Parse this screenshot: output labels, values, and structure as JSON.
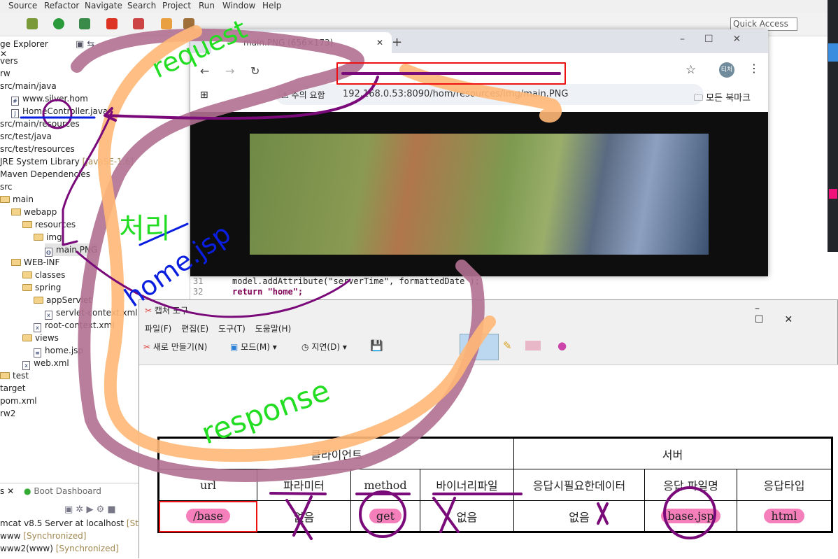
{
  "eclipse": {
    "menu": [
      "Source",
      "Refactor",
      "Navigate",
      "Search",
      "Project",
      "Run",
      "Window",
      "Help"
    ],
    "quick_access": "Quick Access",
    "explorer_tab": "ge Explorer",
    "tree": [
      {
        "label": "vers",
        "indent": 0
      },
      {
        "label": "rw",
        "indent": 0
      },
      {
        "label": "src/main/java",
        "indent": 0
      },
      {
        "label": "www.silver.hom",
        "indent": 1,
        "icon": "package"
      },
      {
        "label": "HomeController.java",
        "indent": 1,
        "icon": "java"
      },
      {
        "label": "src/main/resources",
        "indent": 0
      },
      {
        "label": "src/test/java",
        "indent": 0
      },
      {
        "label": "src/test/resources",
        "indent": 0
      },
      {
        "label": "JRE System Library",
        "suffix": "[JavaSE-1.6]",
        "indent": 0
      },
      {
        "label": "Maven Dependencies",
        "indent": 0
      },
      {
        "label": "src",
        "indent": 0
      },
      {
        "label": "main",
        "indent": 0,
        "icon": "folder"
      },
      {
        "label": "webapp",
        "indent": 1,
        "icon": "folder"
      },
      {
        "label": "resources",
        "indent": 2,
        "icon": "folder"
      },
      {
        "label": "img",
        "indent": 3,
        "icon": "folder"
      },
      {
        "label": "main.PNG",
        "indent": 4,
        "icon": "image"
      },
      {
        "label": "WEB-INF",
        "indent": 1,
        "icon": "folder"
      },
      {
        "label": "classes",
        "indent": 2,
        "icon": "folder"
      },
      {
        "label": "spring",
        "indent": 2,
        "icon": "folder"
      },
      {
        "label": "appServlet",
        "indent": 3,
        "icon": "folder"
      },
      {
        "label": "servlet-context.xml",
        "indent": 4,
        "icon": "xml"
      },
      {
        "label": "root-context.xml",
        "indent": 3,
        "icon": "xml"
      },
      {
        "label": "views",
        "indent": 2,
        "icon": "folder"
      },
      {
        "label": "home.jsp",
        "indent": 3,
        "icon": "jsp"
      },
      {
        "label": "web.xml",
        "indent": 2,
        "icon": "xml"
      },
      {
        "label": "test",
        "indent": 0,
        "icon": "folder"
      },
      {
        "label": "target",
        "indent": 0
      },
      {
        "label": "pom.xml",
        "indent": 0
      },
      {
        "label": "rw2",
        "indent": 0
      }
    ],
    "servers": {
      "tab_left": "s",
      "tab_boot": "Boot Dashboard",
      "rows": [
        {
          "label": "mcat v8.5 Server at localhost",
          "status": "[Starte"
        },
        {
          "label": "www",
          "status": "[Synchronized]"
        },
        {
          "label": "www2(www)",
          "status": "[Synchronized]"
        }
      ]
    },
    "code": [
      {
        "line": "31",
        "text": "model.addAttribute(\"serverTime\", formattedDate );"
      },
      {
        "line": "32",
        "text": "return \"home\";"
      }
    ]
  },
  "chrome": {
    "tab_title": "main.PNG (656×173)",
    "security_label": "주의 요함",
    "url": "192.168.0.53:8090/hom/resources/img/main.PNG",
    "profile": "티처",
    "bookmarks": "모든 북마크"
  },
  "capture_tool": {
    "title": "캡처 도구",
    "menu": [
      "파일(F)",
      "편집(E)",
      "도구(T)",
      "도움말(H)"
    ],
    "new_label": "새로 만들기(N)",
    "mode_label": "모드(M)",
    "delay_label": "지연(D)",
    "table": {
      "groups": [
        "클라이언트",
        "서버"
      ],
      "headers": [
        "url",
        "파라미터",
        "method",
        "바이너리파일",
        "응답시필요한데이터",
        "응답 파일명",
        "응답타입"
      ],
      "values": [
        "/base",
        "없음",
        "get",
        "없음",
        "없음",
        "base.jsp",
        "html"
      ]
    }
  },
  "annotations": {
    "request": "request",
    "response": "response",
    "process": "처리",
    "home_jsp": "home.jsp",
    "colors": {
      "purple": "#7a0a7a",
      "mauve": "#b07090",
      "orange": "#ffb877",
      "green": "#22dd22",
      "blue": "#0a1ee0",
      "red": "#ee1111"
    }
  }
}
